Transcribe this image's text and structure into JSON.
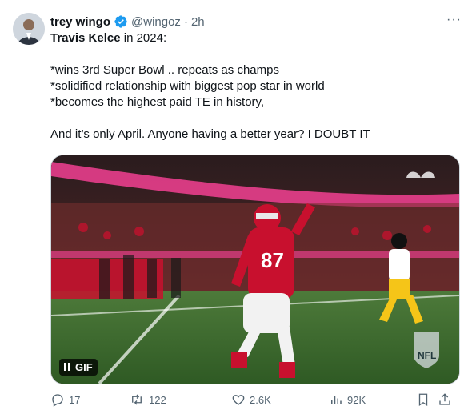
{
  "tweet": {
    "author_name": "trey wingo",
    "handle": "@wingoz",
    "separator": "·",
    "time": "2h",
    "more_label": "···",
    "lines": [
      {
        "bold": "Travis Kelce",
        "text": " in 2024:"
      },
      {
        "text": "*wins 3rd Super Bowl .. repeats as champs"
      },
      {
        "text": "*solidified relationship with biggest pop star in world"
      },
      {
        "text": "*becomes the highest paid TE in history,"
      },
      {
        "text": "And it’s only April. Anyone having a better year? I DOUBT IT"
      }
    ],
    "media": {
      "badge": "GIF",
      "player_number": "87",
      "network_logo": "NFL"
    },
    "actions": {
      "replies": "17",
      "retweets": "122",
      "likes": "2.6K",
      "views": "92K"
    }
  },
  "colors": {
    "verified": "#1d9bf0",
    "secondary_text": "#536471",
    "chiefs_red": "#c8102e",
    "field_green": "#3a6b2e"
  }
}
